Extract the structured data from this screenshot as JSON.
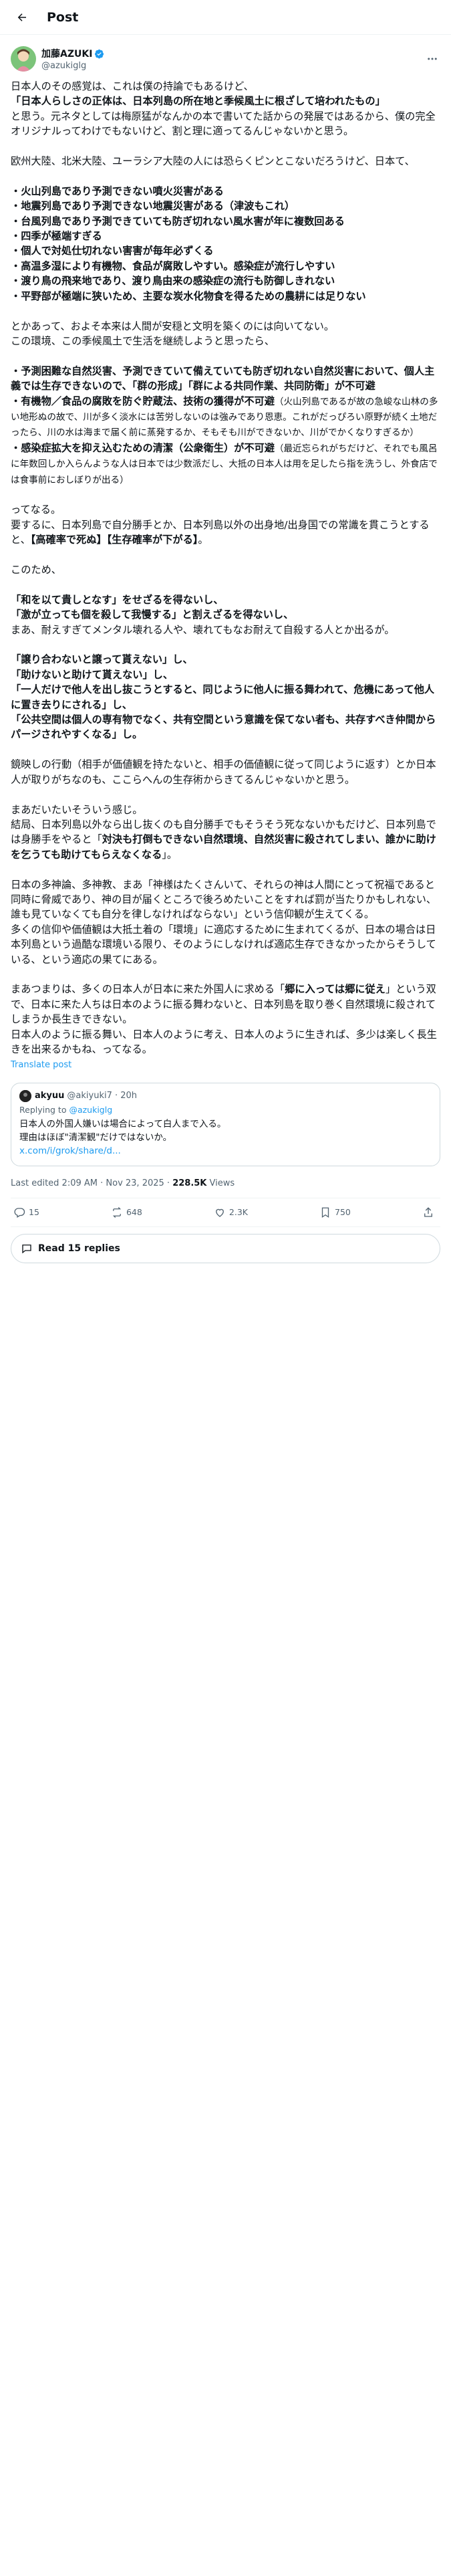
{
  "header": {
    "title": "Post"
  },
  "author": {
    "name": "加藤AZUKI",
    "handle": "@azukiglg"
  },
  "post": {
    "p1_a": "日本人のその感覚は、これは僕の持論でもあるけど、",
    "p1_b": "「日本人らしさの正体は、日本列島の所在地と季候風土に根ざして培われたもの」",
    "p1_c": "と思う。元ネタとしては梅原猛がなんかの本で書いてた話からの発展ではあるから、僕の完全オリジナルってわけでもないけど、割と理に適ってるんじゃないかと思う。",
    "p2": "欧州大陸、北米大陸、ユーラシア大陸の人には恐らくピンとこないだろうけど、日本て、",
    "list1": [
      "・火山列島であり予測できない噴火災害がある",
      "・地震列島であり予測できない地震災害がある（津波もこれ）",
      "・台風列島であり予測できていても防ぎ切れない風水害が年に複数回ある",
      "・四季が極端すぎる",
      "・個人で対処仕切れない害害が毎年必ずくる",
      "・高温多湿により有機物、食品が腐敗しやすい。感染症が流行しやすい",
      "・渡り鳥の飛来地であり、渡り鳥由来の感染症の流行も防御しきれない",
      "・平野部が極端に狭いため、主要な炭水化物食を得るための農耕には足りない"
    ],
    "p3_a": "とかあって、およそ本来は人間が安穏と文明を築くのには向いてない。",
    "p3_b": "この環境、この季候風土で生活を継続しようと思ったら、",
    "list2_1": "・予測困難な自然災害、予測できていて備えていても防ぎ切れない自然災害において、個人主義では生存できないので、「群の形成」「群による共同作業、共同防衛」が不可避",
    "list2_2a": "・有機物／食品の腐敗を防ぐ貯蔵法、技術の獲得が不可避",
    "list2_2b": "（火山列島であるが故の急峻な山林の多い地形ぬの故で、川が多く淡水には苦労しないのは強みであり恩恵。これがだっぴろい原野が続く土地だったら、川の水は海まで届く前に蒸発するか、そもそも川ができないか、川がでかくなりすぎるか）",
    "list2_3a": "・感染症拡大を抑え込むための清潔（公衆衛生）が不可避",
    "list2_3b": "（最近忘られがちだけど、それでも風呂に年数回しか入らんような人は日本では少数派だし、大抵の日本人は用を足したら指を洗うし、外食店では食事前におしぼりが出る）",
    "p4_a": "ってなる。",
    "p4_b": "要するに、日本列島で自分勝手とか、日本列島以外の出身地/出身国での常識を貫こうとすると、",
    "p4_c": "【高確率で死ぬ】【生存確率が下がる】",
    "p4_d": "。",
    "p5": "このため、",
    "list3": [
      "「和を以て貴しとなす」をせざるを得ないし、",
      "「激が立っても個を殺して我慢する」と割えざるを得ないし、"
    ],
    "p6": "まあ、耐えすぎてメンタル壊れる人や、壊れてもなお耐えて自殺する人とか出るが。",
    "list4": [
      "「譲り合わないと譲って貰えない」し、",
      "「助けないと助けて貰えない」し、",
      "「一人だけで他人を出し抜こうとすると、同じように他人に振る舞われて、危機にあって他人に置き去りにされる」し、",
      "「公共空間は個人の専有物でなく、共有空間という意識を保てない者も、共存すべき仲間からパージされやすくなる」し。"
    ],
    "p7": "鏡映しの行動（相手が価値観を持たないと、相手の価値観に従って同じように返す）とか日本人が取りがちなのも、ここらへんの生存術からきてるんじゃないかと思う。",
    "p8": "まあだいたいそういう感じ。",
    "p9_a": "結局、日本列島以外なら出し抜くのも自分勝手でもそうそう死なないかもだけど、日本列島では身勝手をやると「",
    "p9_b": "対決も打倒もできない自然環境、自然災害に殺されてしまい、誰かに助けを乞うても助けてもらえなくなる",
    "p9_c": "」。",
    "p10": "日本の多神論、多神教、まあ「神様はたくさんいて、それらの神は人間にとって祝福であると同時に脅威であり、神の目が届くところで後ろめたいことをすれば罰が当たりかもしれない、誰も見ていなくても自分を律しなければならない」という信仰観が生えてくる。\n多くの信仰や価値観は大抵土着の「環境」に適応するために生まれてくるが、日本の場合は日本列島という過酷な環境いる限り、そのようにしなければ適応生存できなかったからそうしている、という適応の果てにある。",
    "p11_a": "まあつまりは、多くの日本人が日本に来た外国人に求める「",
    "p11_b": "郷に入っては郷に従え",
    "p11_c": "」という双で、日本に来た人ちは日本のように振る舞わないと、日本列島を取り巻く自然環境に殺されてしまうか長生きできない。\n日本人のように振る舞い、日本人のように考え、日本人のように生きれば、多少は楽しく長生きを出来るかもね、ってなる。"
  },
  "translate_label": "Translate post",
  "quote": {
    "name": "akyuu",
    "handle": "@akiyuki7 · 20h",
    "reply_prefix": "Replying to ",
    "reply_handle": "@azukiglg",
    "text": "日本人の外国人嫌いは場合によって白人まで入る。\n理由はほぼ\"清潔観\"だけではないか。",
    "link": "x.com/i/grok/share/d..."
  },
  "meta": {
    "edited": "Last edited 2:09 AM · Nov 23, 2025 · ",
    "views": "228.5K",
    "views_label": " Views"
  },
  "actions": {
    "replies": "15",
    "reposts": "648",
    "likes": "2.3K",
    "bookmarks": "750"
  },
  "read_replies": "Read 15 replies"
}
